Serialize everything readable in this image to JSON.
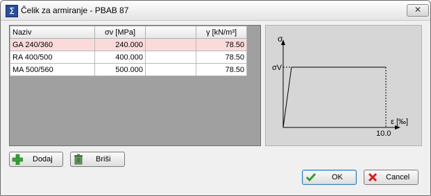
{
  "window": {
    "title": "Čelik za armiranje - PBAB 87"
  },
  "table": {
    "headers": [
      "Naziv",
      "σv [MPa]",
      "",
      "γ [kN/m³]"
    ],
    "rows": [
      {
        "naziv": "GA 240/360",
        "sv": "240.000",
        "empty": "",
        "gamma": "78.50"
      },
      {
        "naziv": "RA 400/500",
        "sv": "400.000",
        "empty": "",
        "gamma": "78.50"
      },
      {
        "naziv": "MA 500/560",
        "sv": "500.000",
        "empty": "",
        "gamma": "78.50"
      }
    ]
  },
  "diagram": {
    "y_axis_label": "σ",
    "yield_label": "σV",
    "x_axis_label": "ε [‰]",
    "x_max_label": "10.0"
  },
  "buttons": {
    "add": "Dodaj",
    "delete": "Briši",
    "ok": "OK",
    "cancel": "Cancel"
  },
  "colors": {
    "selected_row": "#fbdada",
    "grid_bg": "#a0a0a0",
    "diagram_bg": "#d6d6d6"
  }
}
